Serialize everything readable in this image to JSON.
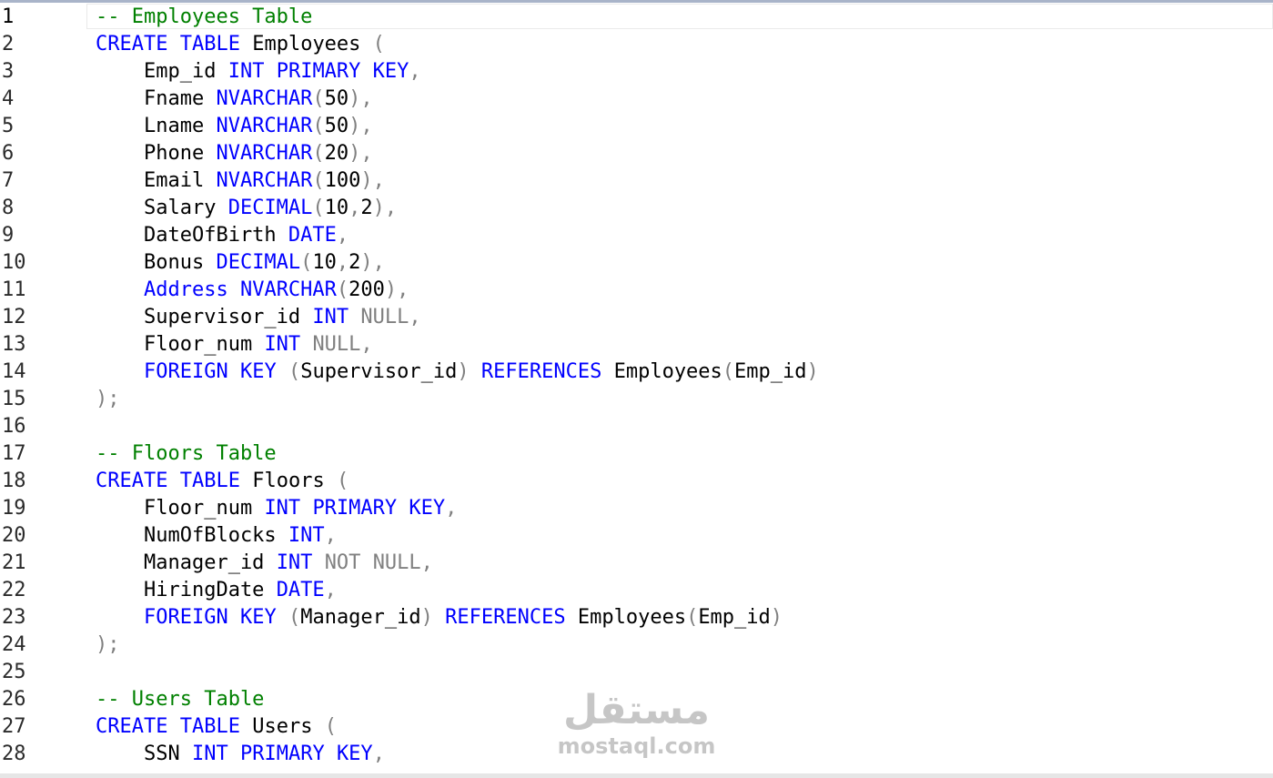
{
  "editor": {
    "current_line": 1,
    "lines": [
      [
        {
          "t": "-- Employees Table",
          "k": "cm"
        }
      ],
      [
        {
          "t": "CREATE",
          "k": "kw"
        },
        {
          "t": " "
        },
        {
          "t": "TABLE",
          "k": "kw"
        },
        {
          "t": " Employees "
        },
        {
          "t": "(",
          "k": "pn"
        }
      ],
      [
        {
          "t": "    Emp_id "
        },
        {
          "t": "INT",
          "k": "kw"
        },
        {
          "t": " "
        },
        {
          "t": "PRIMARY",
          "k": "kw"
        },
        {
          "t": " "
        },
        {
          "t": "KEY",
          "k": "kw"
        },
        {
          "t": ",",
          "k": "pn"
        }
      ],
      [
        {
          "t": "    Fname "
        },
        {
          "t": "NVARCHAR",
          "k": "kw"
        },
        {
          "t": "(",
          "k": "pn"
        },
        {
          "t": "50"
        },
        {
          "t": "),",
          "k": "pn"
        }
      ],
      [
        {
          "t": "    Lname "
        },
        {
          "t": "NVARCHAR",
          "k": "kw"
        },
        {
          "t": "(",
          "k": "pn"
        },
        {
          "t": "50"
        },
        {
          "t": "),",
          "k": "pn"
        }
      ],
      [
        {
          "t": "    Phone "
        },
        {
          "t": "NVARCHAR",
          "k": "kw"
        },
        {
          "t": "(",
          "k": "pn"
        },
        {
          "t": "20"
        },
        {
          "t": "),",
          "k": "pn"
        }
      ],
      [
        {
          "t": "    Email "
        },
        {
          "t": "NVARCHAR",
          "k": "kw"
        },
        {
          "t": "(",
          "k": "pn"
        },
        {
          "t": "100"
        },
        {
          "t": "),",
          "k": "pn"
        }
      ],
      [
        {
          "t": "    Salary "
        },
        {
          "t": "DECIMAL",
          "k": "kw"
        },
        {
          "t": "(",
          "k": "pn"
        },
        {
          "t": "10"
        },
        {
          "t": ",",
          "k": "pn"
        },
        {
          "t": "2"
        },
        {
          "t": "),",
          "k": "pn"
        }
      ],
      [
        {
          "t": "    DateOfBirth "
        },
        {
          "t": "DATE",
          "k": "kw"
        },
        {
          "t": ",",
          "k": "pn"
        }
      ],
      [
        {
          "t": "    Bonus "
        },
        {
          "t": "DECIMAL",
          "k": "kw"
        },
        {
          "t": "(",
          "k": "pn"
        },
        {
          "t": "10"
        },
        {
          "t": ",",
          "k": "pn"
        },
        {
          "t": "2"
        },
        {
          "t": "),",
          "k": "pn"
        }
      ],
      [
        {
          "t": "    "
        },
        {
          "t": "Address",
          "k": "kw"
        },
        {
          "t": " "
        },
        {
          "t": "NVARCHAR",
          "k": "kw"
        },
        {
          "t": "(",
          "k": "pn"
        },
        {
          "t": "200"
        },
        {
          "t": "),",
          "k": "pn"
        }
      ],
      [
        {
          "t": "    Supervisor_id "
        },
        {
          "t": "INT",
          "k": "kw"
        },
        {
          "t": " "
        },
        {
          "t": "NULL",
          "k": "sys"
        },
        {
          "t": ",",
          "k": "pn"
        }
      ],
      [
        {
          "t": "    Floor_num "
        },
        {
          "t": "INT",
          "k": "kw"
        },
        {
          "t": " "
        },
        {
          "t": "NULL",
          "k": "sys"
        },
        {
          "t": ",",
          "k": "pn"
        }
      ],
      [
        {
          "t": "    "
        },
        {
          "t": "FOREIGN",
          "k": "kw"
        },
        {
          "t": " "
        },
        {
          "t": "KEY",
          "k": "kw"
        },
        {
          "t": " "
        },
        {
          "t": "(",
          "k": "pn"
        },
        {
          "t": "Supervisor_id"
        },
        {
          "t": ")",
          "k": "pn"
        },
        {
          "t": " "
        },
        {
          "t": "REFERENCES",
          "k": "kw"
        },
        {
          "t": " Employees"
        },
        {
          "t": "(",
          "k": "pn"
        },
        {
          "t": "Emp_id"
        },
        {
          "t": ")",
          "k": "pn"
        }
      ],
      [
        {
          "t": ");",
          "k": "pn"
        }
      ],
      [],
      [
        {
          "t": "-- Floors Table",
          "k": "cm"
        }
      ],
      [
        {
          "t": "CREATE",
          "k": "kw"
        },
        {
          "t": " "
        },
        {
          "t": "TABLE",
          "k": "kw"
        },
        {
          "t": " Floors "
        },
        {
          "t": "(",
          "k": "pn"
        }
      ],
      [
        {
          "t": "    Floor_num "
        },
        {
          "t": "INT",
          "k": "kw"
        },
        {
          "t": " "
        },
        {
          "t": "PRIMARY",
          "k": "kw"
        },
        {
          "t": " "
        },
        {
          "t": "KEY",
          "k": "kw"
        },
        {
          "t": ",",
          "k": "pn"
        }
      ],
      [
        {
          "t": "    NumOfBlocks "
        },
        {
          "t": "INT",
          "k": "kw"
        },
        {
          "t": ",",
          "k": "pn"
        }
      ],
      [
        {
          "t": "    Manager_id "
        },
        {
          "t": "INT",
          "k": "kw"
        },
        {
          "t": " "
        },
        {
          "t": "NOT",
          "k": "sys"
        },
        {
          "t": " "
        },
        {
          "t": "NULL",
          "k": "sys"
        },
        {
          "t": ",",
          "k": "pn"
        }
      ],
      [
        {
          "t": "    HiringDate "
        },
        {
          "t": "DATE",
          "k": "kw"
        },
        {
          "t": ",",
          "k": "pn"
        }
      ],
      [
        {
          "t": "    "
        },
        {
          "t": "FOREIGN",
          "k": "kw"
        },
        {
          "t": " "
        },
        {
          "t": "KEY",
          "k": "kw"
        },
        {
          "t": " "
        },
        {
          "t": "(",
          "k": "pn"
        },
        {
          "t": "Manager_id"
        },
        {
          "t": ")",
          "k": "pn"
        },
        {
          "t": " "
        },
        {
          "t": "REFERENCES",
          "k": "kw"
        },
        {
          "t": " Employees"
        },
        {
          "t": "(",
          "k": "pn"
        },
        {
          "t": "Emp_id"
        },
        {
          "t": ")",
          "k": "pn"
        }
      ],
      [
        {
          "t": ");",
          "k": "pn"
        }
      ],
      [],
      [
        {
          "t": "-- Users Table",
          "k": "cm"
        }
      ],
      [
        {
          "t": "CREATE",
          "k": "kw"
        },
        {
          "t": " "
        },
        {
          "t": "TABLE",
          "k": "kw"
        },
        {
          "t": " Users "
        },
        {
          "t": "(",
          "k": "pn"
        }
      ],
      [
        {
          "t": "    SSN "
        },
        {
          "t": "INT",
          "k": "kw"
        },
        {
          "t": " "
        },
        {
          "t": "PRIMARY",
          "k": "kw"
        },
        {
          "t": " "
        },
        {
          "t": "KEY",
          "k": "kw"
        },
        {
          "t": ",",
          "k": "pn"
        }
      ]
    ]
  },
  "watermark": {
    "arabic": "مستقل",
    "latin": "mostaql.com"
  },
  "colors": {
    "keyword": "#0000ff",
    "comment": "#008000",
    "punctuation": "#808080",
    "system": "#808080",
    "identifier": "#000000"
  }
}
